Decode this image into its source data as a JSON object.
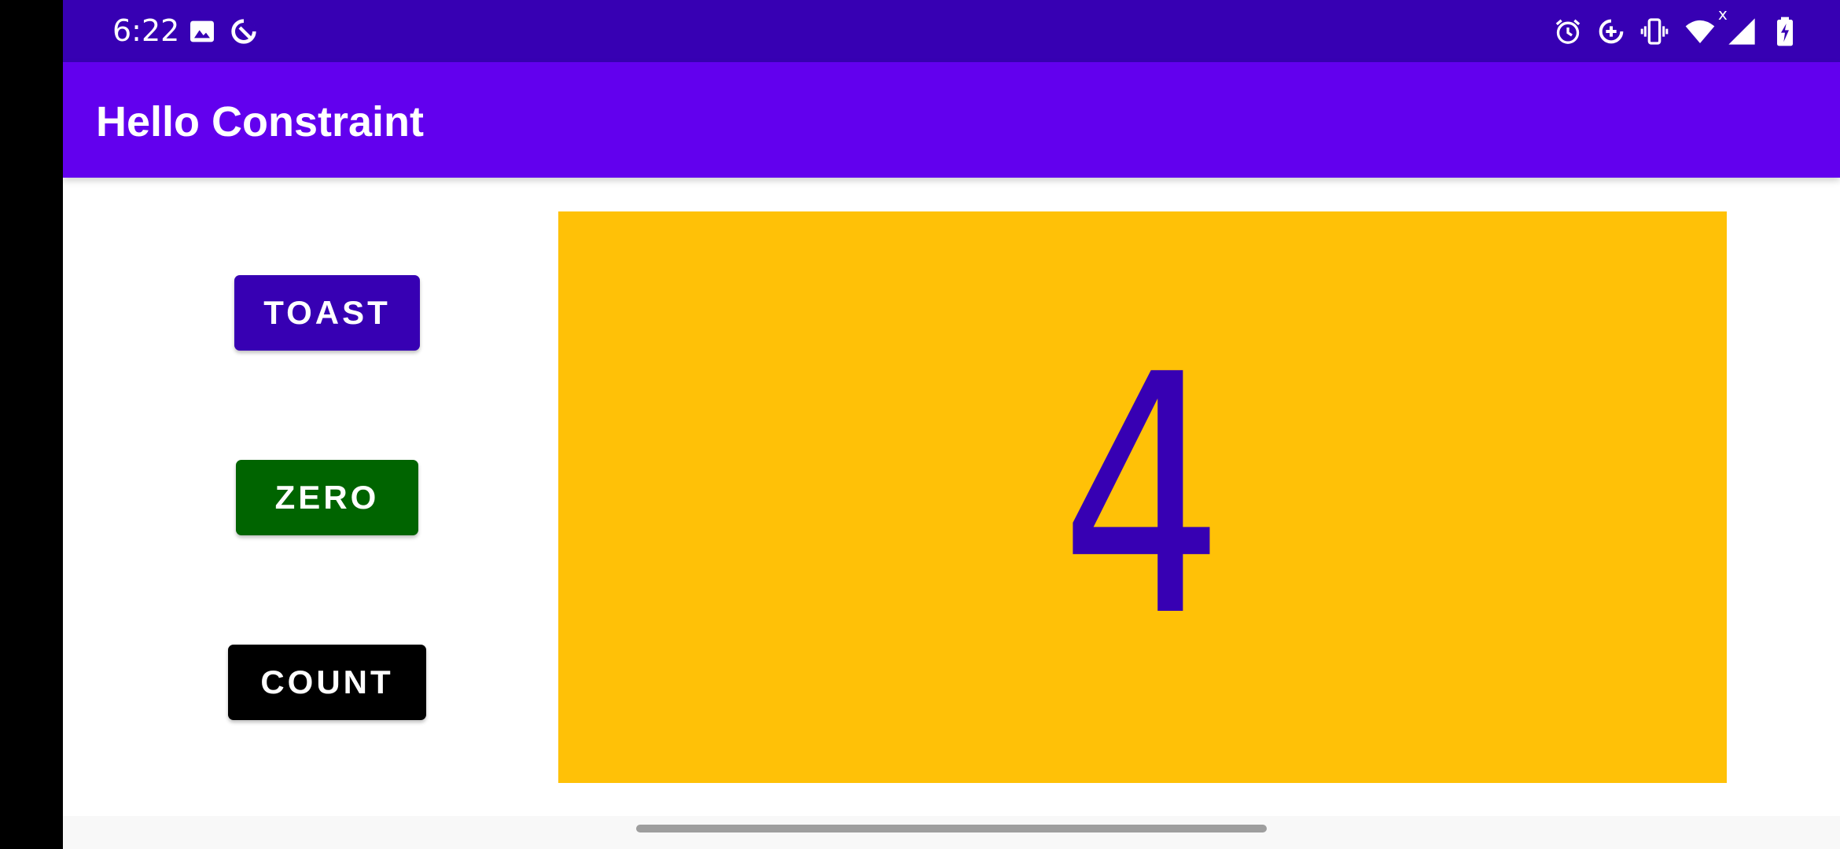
{
  "status_bar": {
    "time": "6:22",
    "left_icons": [
      "image-icon",
      "data-saver-icon"
    ],
    "right_icons": [
      "alarm-icon",
      "data-saver-plus-icon",
      "vibrate-icon",
      "wifi-icon",
      "signal-icon",
      "battery-charging-icon"
    ],
    "signal_badge": "x",
    "background": "#3700B3"
  },
  "app_bar": {
    "title": "Hello Constraint",
    "background": "#6200EE"
  },
  "buttons": {
    "toast": {
      "label": "TOAST",
      "color": "#3700B3"
    },
    "zero": {
      "label": "ZERO",
      "color": "#006400"
    },
    "count": {
      "label": "COUNT",
      "color": "#000000"
    }
  },
  "counter": {
    "value": "4",
    "background": "#FFC107",
    "text_color": "#3700B3"
  }
}
